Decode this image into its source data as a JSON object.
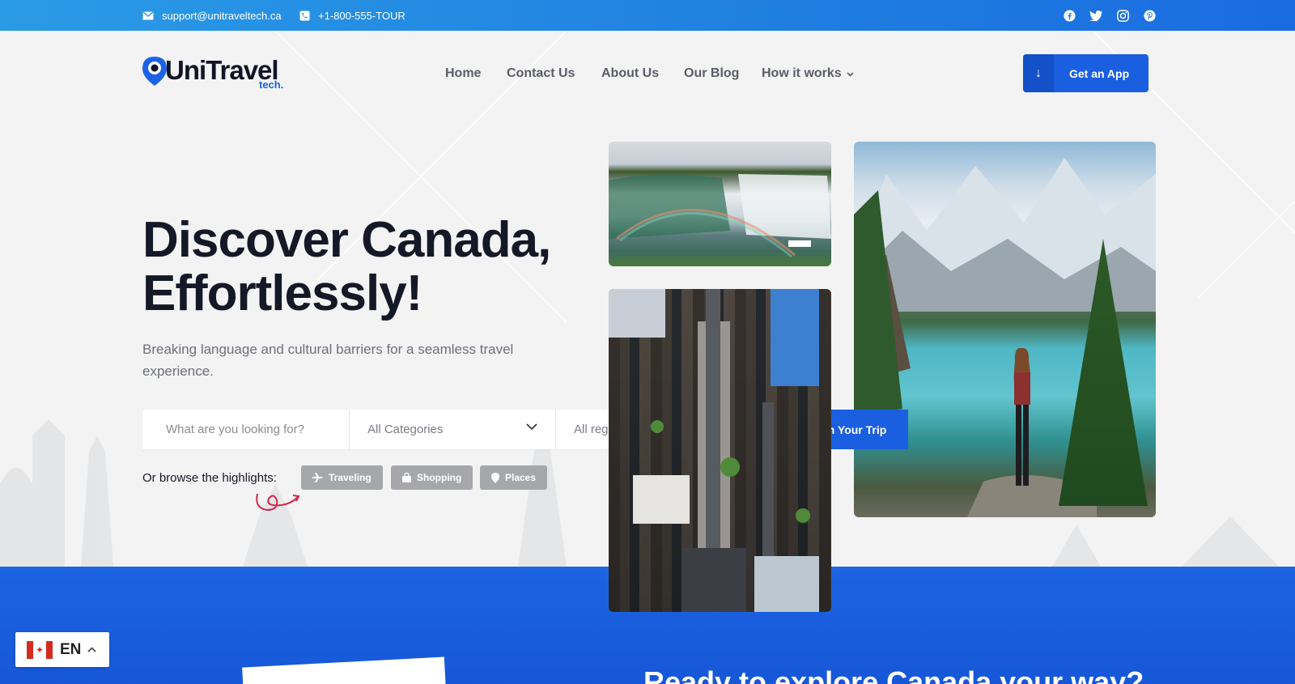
{
  "topbar": {
    "email": "support@unitraveltech.ca",
    "phone": "+1-800-555-TOUR",
    "social": [
      "facebook-icon",
      "twitter-icon",
      "instagram-icon",
      "pinterest-icon"
    ]
  },
  "header": {
    "logo_main": "UniTravel",
    "logo_sub": "tech.",
    "nav": [
      "Home",
      "Contact Us",
      "About Us",
      "Our Blog",
      "How it works"
    ],
    "cta_label": "Get an App"
  },
  "hero": {
    "headline_line1": "Discover Canada,",
    "headline_line2": "Effortlessly!",
    "subtitle": "Breaking language and cultural barriers for a seamless travel experience.",
    "search_placeholder": "What are you looking for?",
    "category_select": "All Categories",
    "region_select": "All regions",
    "plan_button": "Plan Your Trip",
    "browse_label": "Or browse the highlights:",
    "chips": [
      "Traveling",
      "Shopping",
      "Places"
    ]
  },
  "section2": {
    "title": "Ready to explore Canada your way?"
  },
  "language": {
    "code": "EN"
  },
  "colors": {
    "primary": "#1a5fe0",
    "topbar": "#1f7fe0",
    "chip": "#a6a7ab",
    "heading": "#151826"
  }
}
